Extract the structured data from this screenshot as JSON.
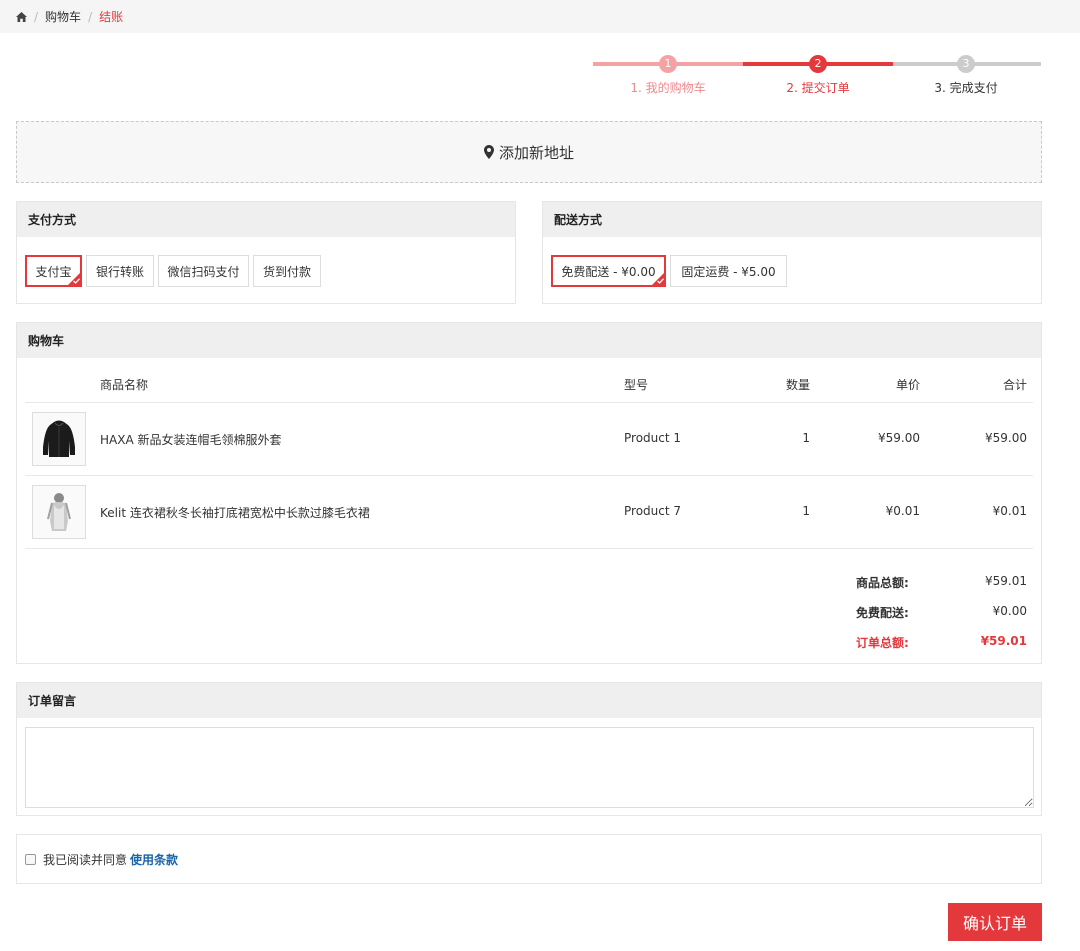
{
  "breadcrumb": {
    "home_icon": "home-icon",
    "items": [
      "购物车",
      "结账"
    ]
  },
  "steps": [
    {
      "num": "1",
      "label": "1. 我的购物车"
    },
    {
      "num": "2",
      "label": "2. 提交订单"
    },
    {
      "num": "3",
      "label": "3. 完成支付"
    }
  ],
  "address": {
    "icon": "map-marker-icon",
    "label": "添加新地址"
  },
  "payment": {
    "title": "支付方式",
    "options": [
      "支付宝",
      "银行转账",
      "微信扫码支付",
      "货到付款"
    ],
    "selected": "支付宝"
  },
  "shipping": {
    "title": "配送方式",
    "options": [
      "免费配送 - ¥0.00",
      "固定运费 - ¥5.00"
    ],
    "selected": "免费配送 - ¥0.00"
  },
  "cart": {
    "title": "购物车",
    "headers": {
      "name": "商品名称",
      "model": "型号",
      "qty": "数量",
      "price": "单价",
      "total": "合计"
    },
    "items": [
      {
        "name": "HAXA 新品女装连帽毛领棉服外套",
        "model": "Product 1",
        "qty": "1",
        "price": "¥59.00",
        "total": "¥59.00"
      },
      {
        "name": "Kelit 连衣裙秋冬长袖打底裙宽松中长款过膝毛衣裙",
        "model": "Product 7",
        "qty": "1",
        "price": "¥0.01",
        "total": "¥0.01"
      }
    ],
    "summary": {
      "subtotal_label": "商品总额:",
      "subtotal": "¥59.01",
      "shipping_label": "免费配送:",
      "shipping": "¥0.00",
      "total_label": "订单总额:",
      "total": "¥59.01"
    }
  },
  "comment": {
    "title": "订单留言",
    "value": ""
  },
  "terms": {
    "text": "我已阅读并同意",
    "link": "使用条款"
  },
  "confirm_label": "确认订单",
  "colors": {
    "accent": "#e4393c",
    "accent_light": "#f4a2a4",
    "inactive": "#cccccc",
    "link": "#1a64a8"
  }
}
